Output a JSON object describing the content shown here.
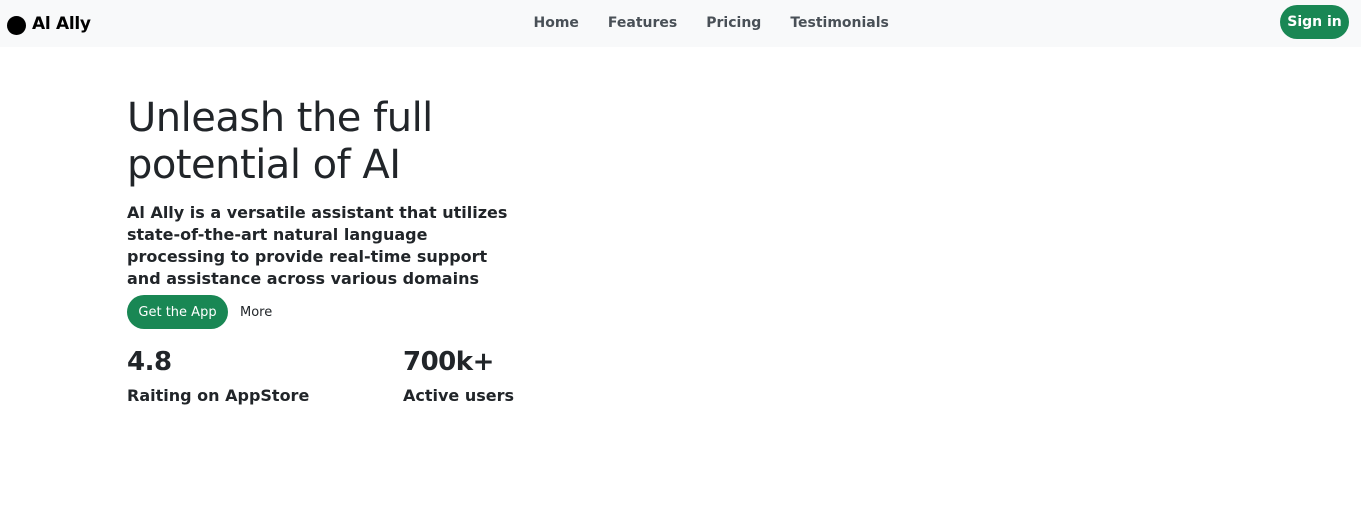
{
  "navbar": {
    "brand": {
      "name": "Al Ally",
      "logo_icon": "circle-logo-icon"
    },
    "links": [
      {
        "label": "Home"
      },
      {
        "label": "Features"
      },
      {
        "label": "Pricing"
      },
      {
        "label": "Testimonials"
      }
    ],
    "signin_label": "Sign in"
  },
  "hero": {
    "title": "Unleash the full potential of AI",
    "description": "Al Ally is a versatile assistant that utilizes state-of-the-art natural language processing to provide real-time support and assistance across various domains",
    "primary_cta_label": "Get the App",
    "secondary_cta_label": "More"
  },
  "stats": [
    {
      "value": "4.8",
      "label": "Raiting on AppStore"
    },
    {
      "value": "700k+",
      "label": "Active users"
    }
  ],
  "colors": {
    "accent": "#198754",
    "navbar_bg": "#f8f9fa",
    "text": "#212529",
    "nav_text": "#495057"
  }
}
